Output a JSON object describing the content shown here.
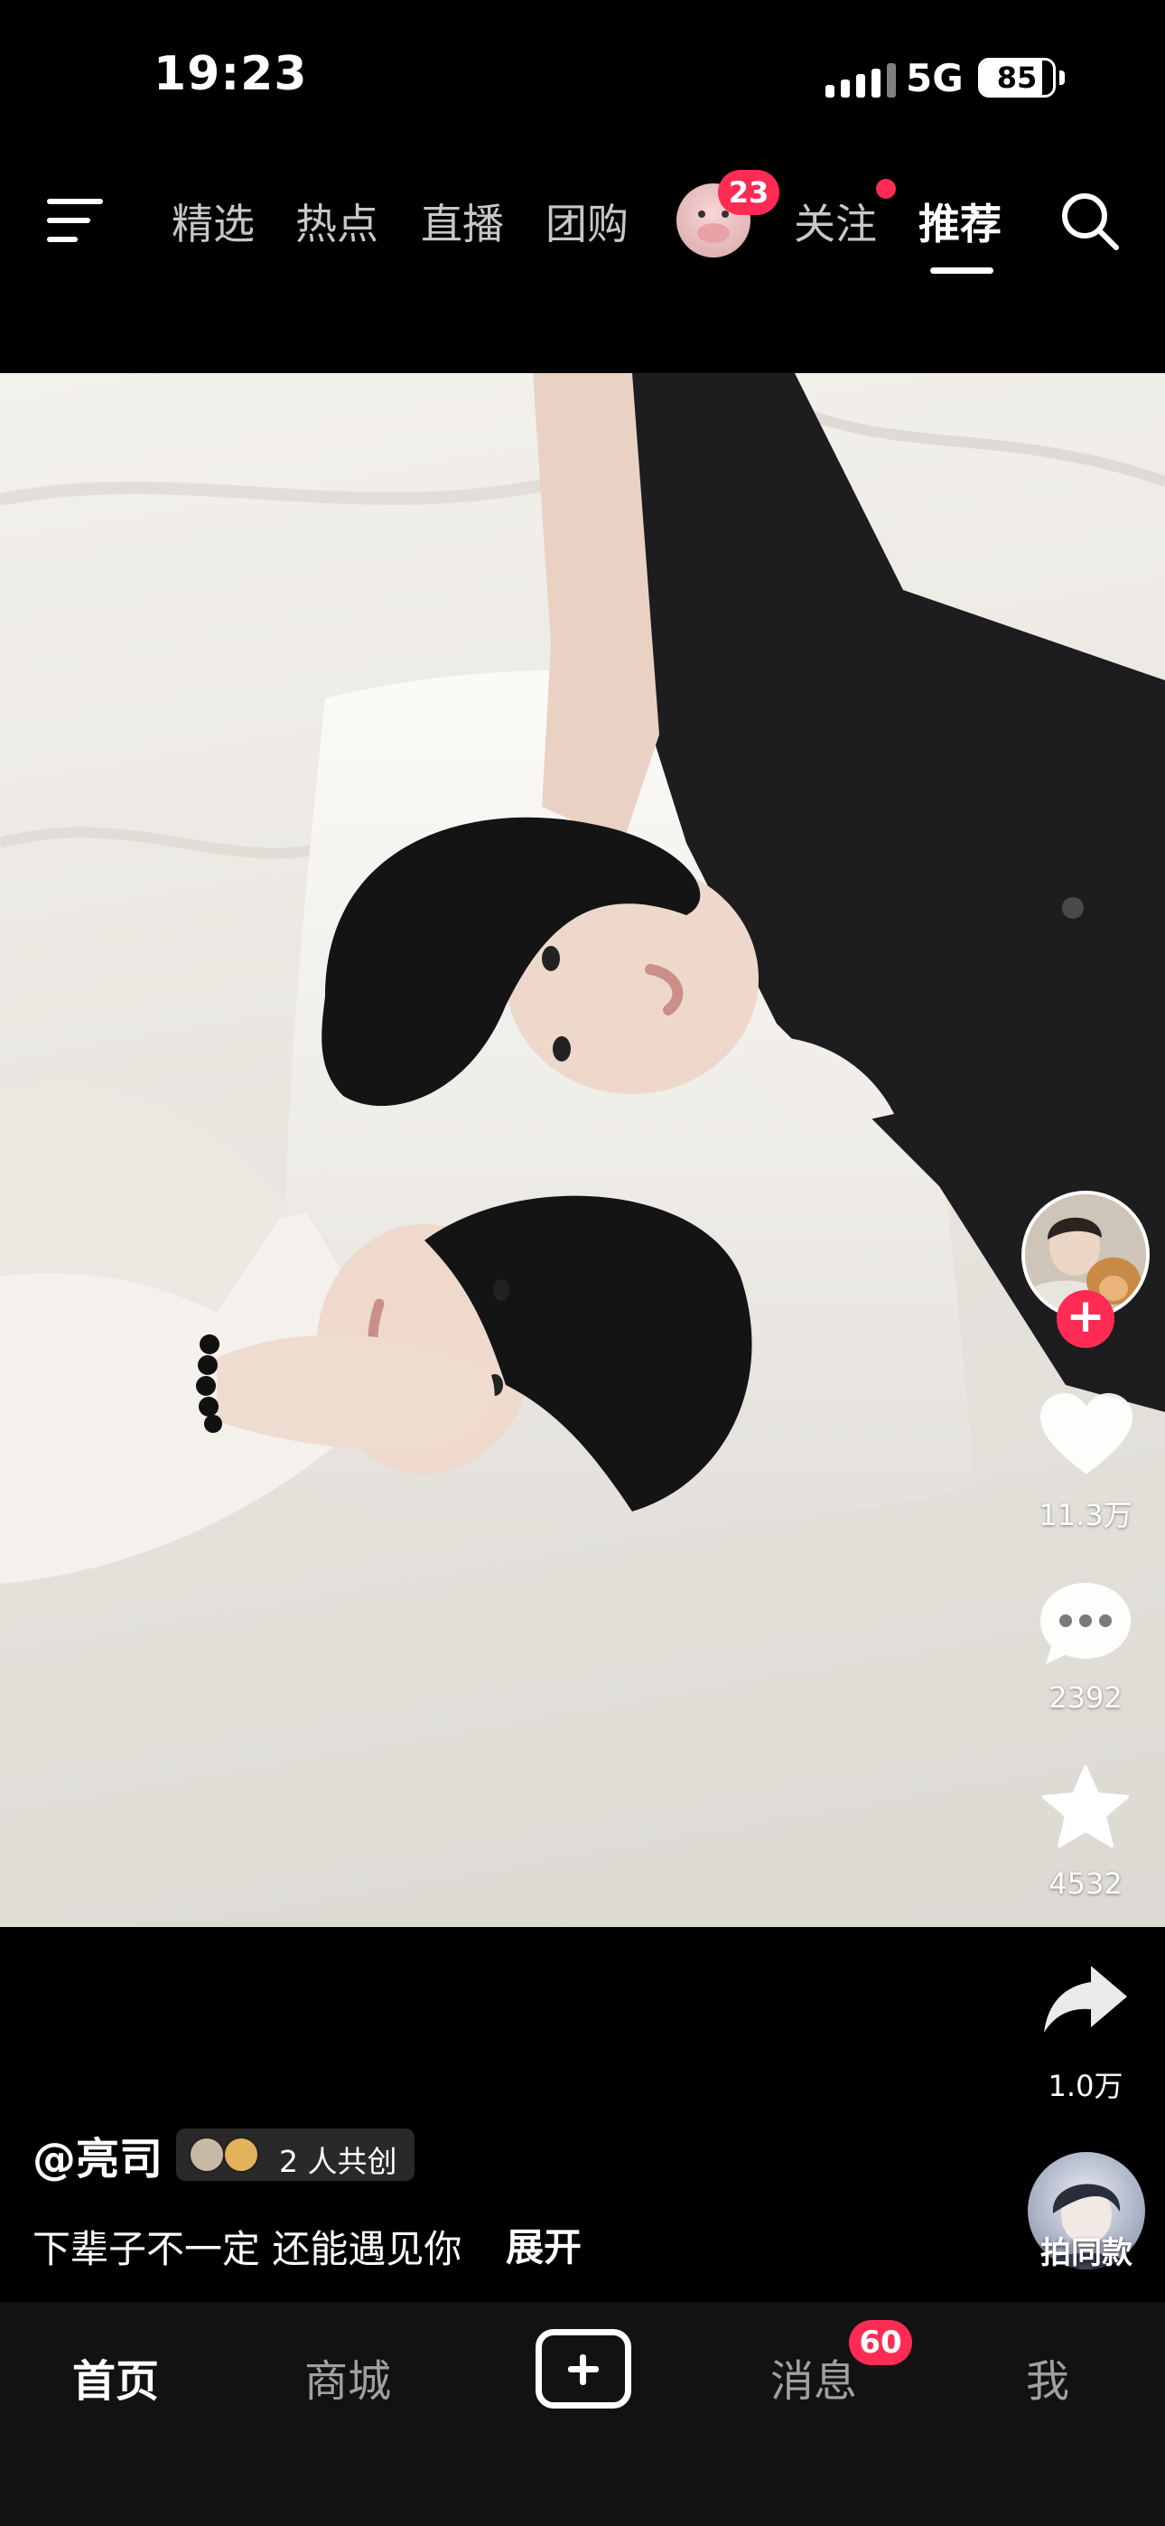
{
  "status_bar": {
    "time": "19:23",
    "network": "5G",
    "battery": "85",
    "battery_level": 0.85
  },
  "top_nav": {
    "tabs": [
      {
        "label": "精选"
      },
      {
        "label": "热点"
      },
      {
        "label": "直播"
      },
      {
        "label": "团购"
      },
      {
        "label": "关注"
      },
      {
        "label": "推荐",
        "active": true
      }
    ],
    "avatar_badge": "23",
    "icons": [
      "menu-icon",
      "search-icon"
    ]
  },
  "actions": {
    "likes": "11.3万",
    "comments": "2392",
    "favorites": "4532",
    "shares": "1.0万",
    "follow_icon": "plus-icon"
  },
  "post": {
    "author": "@亮司",
    "cocreate_label": "2 人共创",
    "caption": "下辈子不一定 还能遇见你",
    "expand_label": "展开",
    "same_style_label": "拍同款"
  },
  "bottom_nav": {
    "home": "首页",
    "mall": "商城",
    "messages": "消息",
    "messages_badge": "60",
    "me": "我"
  },
  "colors": {
    "accent": "#fe2c55",
    "background": "#000000",
    "tabbar": "#121212"
  }
}
